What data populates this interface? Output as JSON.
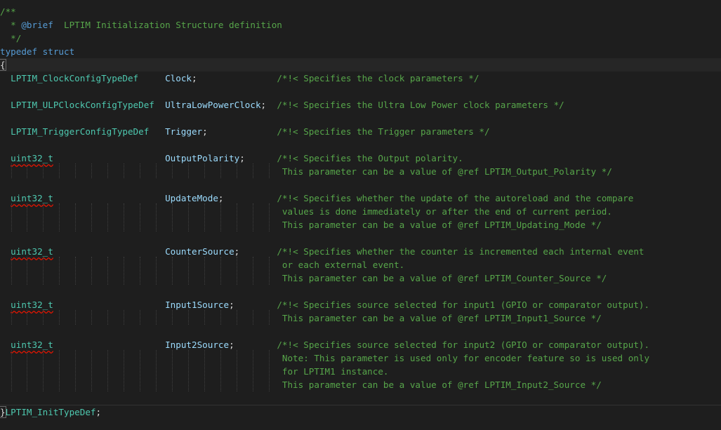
{
  "editor": {
    "header_comment": {
      "open": "/**",
      "brief_tag": "@brief",
      "brief_text": "  LPTIM Initialization Structure definition",
      "close": "  */"
    },
    "typedef_keyword": "typedef",
    "struct_keyword": "struct",
    "open_brace": "{",
    "close_brace": "}",
    "typedef_name": "LPTIM_InitTypeDef",
    "members": [
      {
        "type": "LPTIM_ClockConfigTypeDef",
        "name": "Clock",
        "comment": [
          "/*!< Specifies the clock parameters */"
        ]
      },
      {
        "type": "LPTIM_ULPClockConfigTypeDef",
        "name": "UltraLowPowerClock",
        "comment": [
          "/*!< Specifies the Ultra Low Power clock parameters */"
        ]
      },
      {
        "type": "LPTIM_TriggerConfigTypeDef",
        "name": "Trigger",
        "comment": [
          "/*!< Specifies the Trigger parameters */"
        ]
      },
      {
        "type": "uint32_t",
        "name": "OutputPolarity",
        "comment": [
          "/*!< Specifies the Output polarity.",
          "This parameter can be a value of @ref LPTIM_Output_Polarity */"
        ]
      },
      {
        "type": "uint32_t",
        "name": "UpdateMode",
        "comment": [
          "/*!< Specifies whether the update of the autoreload and the compare",
          "values is done immediately or after the end of current period.",
          "This parameter can be a value of @ref LPTIM_Updating_Mode */"
        ]
      },
      {
        "type": "uint32_t",
        "name": "CounterSource",
        "comment": [
          "/*!< Specifies whether the counter is incremented each internal event",
          "or each external event.",
          "This parameter can be a value of @ref LPTIM_Counter_Source */"
        ]
      },
      {
        "type": "uint32_t",
        "name": "Input1Source",
        "comment": [
          "/*!< Specifies source selected for input1 (GPIO or comparator output).",
          "This parameter can be a value of @ref LPTIM_Input1_Source */"
        ]
      },
      {
        "type": "uint32_t",
        "name": "Input2Source",
        "comment": [
          "/*!< Specifies source selected for input2 (GPIO or comparator output).",
          "Note: This parameter is used only for encoder feature so is used only",
          "for LPTIM1 instance.",
          "This parameter can be a value of @ref LPTIM_Input2_Source */"
        ]
      }
    ],
    "colors": {
      "background": "#1e1e1e",
      "comment": "#57a64a",
      "keyword": "#569cd6",
      "type": "#4ec9b0",
      "identifier": "#9cdcfe",
      "squiggle": "#e51400"
    }
  }
}
